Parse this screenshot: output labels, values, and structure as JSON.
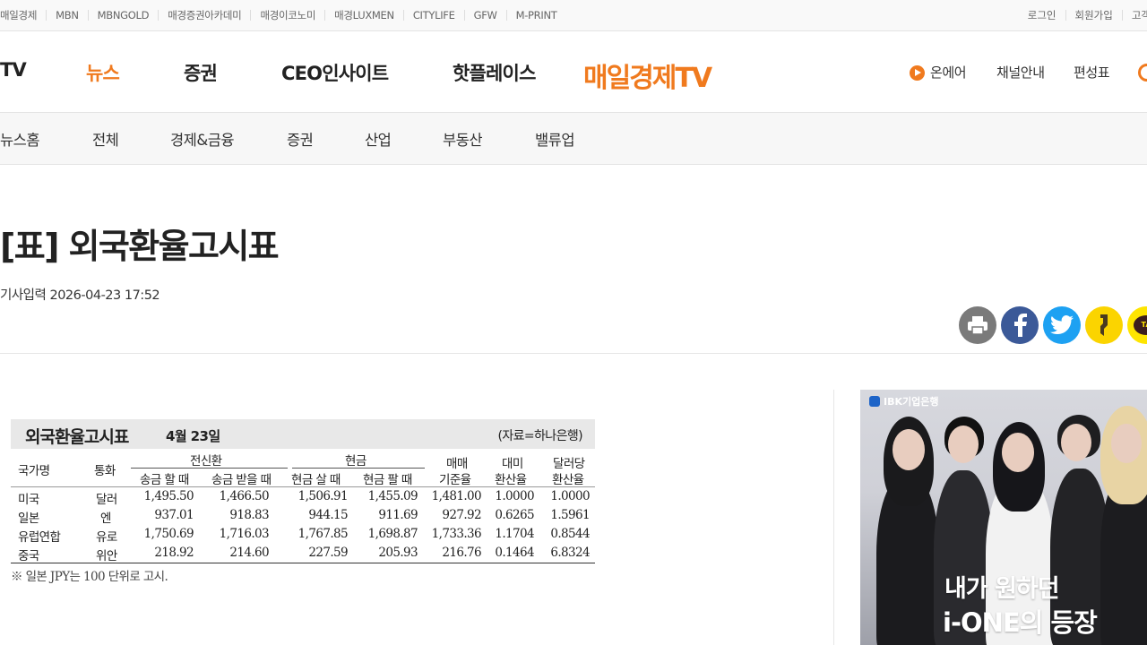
{
  "top_links": [
    "매일경제",
    "MBN",
    "MBNGOLD",
    "매경증권아카데미",
    "매경이코노미",
    "매경LUXMEN",
    "CITYLIFE",
    "GFW",
    "M-PRINT"
  ],
  "account_links": [
    "로그인",
    "회원가입",
    "고객"
  ],
  "main_nav": {
    "items": [
      "TV",
      "뉴스",
      "증권",
      "CEO인사이트",
      "핫플레이스"
    ],
    "active": "뉴스",
    "logo": "매일경제TV",
    "onair": "온에어",
    "channel": "채널안내",
    "schedule": "편성표"
  },
  "sub_nav": [
    "뉴스홈",
    "전체",
    "경제&금융",
    "증권",
    "산업",
    "부동산",
    "밸류업"
  ],
  "article": {
    "title": "[표] 외국환율고시표",
    "date_label": "기사입력",
    "date": "2026-04-23 17:52"
  },
  "share": {
    "kakaotalk_label": "TA"
  },
  "fx_table": {
    "title": "외국환율고시표",
    "date": "4월 23일",
    "source": "(자료=하나은행)",
    "headers": {
      "country": "국가명",
      "currency": "통화",
      "telegraphic": "전신환",
      "cash": "현금",
      "tt_send": "송금 할 때",
      "tt_receive": "송금 받을 때",
      "cash_buy": "현금 살 때",
      "cash_sell": "현금 팔 때",
      "base_1": "매매",
      "base_2": "기준율",
      "usd_1": "대미",
      "usd_2": "환산율",
      "per_usd_1": "달러당",
      "per_usd_2": "환산율"
    },
    "rows": [
      {
        "country": "미국",
        "currency": "달러",
        "tt_send": "1,495.50",
        "tt_receive": "1,466.50",
        "cash_buy": "1,506.91",
        "cash_sell": "1,455.09",
        "base": "1,481.00",
        "usd": "1.0000",
        "per_usd": "1.0000"
      },
      {
        "country": "일본",
        "currency": "엔",
        "tt_send": "937.01",
        "tt_receive": "918.83",
        "cash_buy": "944.15",
        "cash_sell": "911.69",
        "base": "927.92",
        "usd": "0.6265",
        "per_usd": "1.5961"
      },
      {
        "country": "유럽연합",
        "currency": "유로",
        "tt_send": "1,750.69",
        "tt_receive": "1,716.03",
        "cash_buy": "1,767.85",
        "cash_sell": "1,698.87",
        "base": "1,733.36",
        "usd": "1.1704",
        "per_usd": "0.8544"
      },
      {
        "country": "중국",
        "currency": "위안",
        "tt_send": "218.92",
        "tt_receive": "214.60",
        "cash_buy": "227.59",
        "cash_sell": "205.93",
        "base": "216.76",
        "usd": "0.1464",
        "per_usd": "6.8324"
      }
    ],
    "note": "※ 일본 JPY는 100 단위로 고시."
  },
  "ad": {
    "brand": "IBK기업은행",
    "line1": "내가 원하던",
    "line2": "i-ONE의 등장"
  },
  "colors": {
    "accent": "#f07a1e",
    "facebook": "#3b5998",
    "twitter": "#1da1f2",
    "kakaostory": "#fbd400",
    "kakaotalk": "#fee500",
    "print": "#7a7a7a"
  }
}
